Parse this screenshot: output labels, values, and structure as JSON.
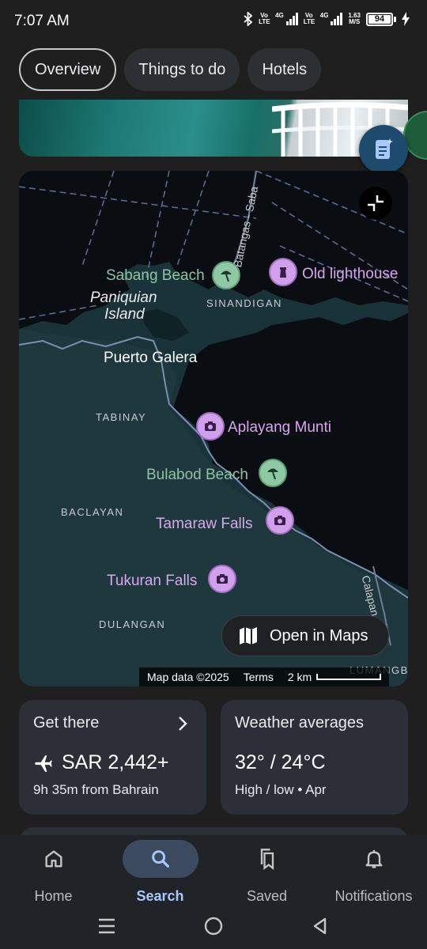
{
  "status_bar": {
    "time": "7:07 AM",
    "net1": "Vo LTE",
    "net1_type": "4G",
    "net2": "Vo LTE",
    "net2_type": "4G",
    "speed_value": "1.63",
    "speed_unit": "M/S",
    "battery": "94"
  },
  "tabs": [
    {
      "label": "Overview",
      "active": true
    },
    {
      "label": "Things to do",
      "active": false
    },
    {
      "label": "Hotels",
      "active": false
    }
  ],
  "map": {
    "road_label": "Batangas - Saba",
    "road_label2": "Calapan Road",
    "places": {
      "puerto_galera": "Puerto Galera",
      "paniquian_line1": "Paniquian",
      "paniquian_line2": "Island",
      "sinandigan": "SINANDIGAN",
      "tabinay": "TABINAY",
      "baclayan": "BACLAYAN",
      "dulangan": "DULANGAN",
      "lumangb": "LUMANGB"
    },
    "pois": {
      "sabang_beach": "Sabang Beach",
      "old_lighthouse": "Old lighthouse",
      "aplayang_munti": "Aplayang Munti",
      "bulabod_beach": "Bulabod Beach",
      "tamaraw_falls": "Tamaraw Falls",
      "tukuran_falls": "Tukuran Falls"
    },
    "open_in_maps": "Open in Maps",
    "attribution": "Map data ©2025",
    "terms": "Terms",
    "scale": "2 km"
  },
  "cards": {
    "get_there": {
      "title": "Get there",
      "price": "SAR 2,442+",
      "detail": "9h 35m from Bahrain"
    },
    "weather": {
      "title": "Weather averages",
      "temps": "32° / 24°C",
      "detail": "High / low • Apr"
    }
  },
  "bottom_nav": [
    {
      "label": "Home",
      "icon": "home-icon"
    },
    {
      "label": "Search",
      "icon": "search-icon",
      "active": true
    },
    {
      "label": "Saved",
      "icon": "bookmarks-icon"
    },
    {
      "label": "Notifications",
      "icon": "bell-icon"
    }
  ],
  "colors": {
    "background": "#1f1f1f",
    "card": "#2c2f38",
    "accent": "#a8c7fa",
    "poi_green": "#8fc9a4",
    "poi_purple": "#d0a0ec"
  }
}
